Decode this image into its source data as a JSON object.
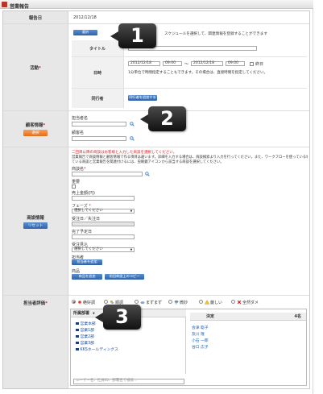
{
  "window": {
    "title": "営業報告"
  },
  "report_date": {
    "label": "報告日",
    "value": "2012/12/18"
  },
  "activity": {
    "label": "活動",
    "select_button": "選択",
    "select_hint": "スケジュールを選択して、関連情報を登録することができます",
    "title_label": "タイトル",
    "datetime_label": "日時",
    "start_date": "2012/12/18",
    "start_time": "09:00",
    "tilde": "～",
    "end_date": "2012/12/18",
    "end_time": "09:00",
    "allday_label": "終日",
    "time_hint": "1分単位で時間指定することもできます。その場合は、直接時間を指定してください。",
    "companion_label": "同行者",
    "companion_button": "同行者を追加する"
  },
  "customer": {
    "label": "顧客情報",
    "button": "選択",
    "contact_label": "担当者名",
    "customer_label": "顧客名"
  },
  "deal": {
    "label": "商談情報",
    "reset_button": "リセット",
    "notice_1": "二回目以降の商談はお客様と入力した商談を選択してください。",
    "notice_2": "営業報告で商談情報と顧客情報で作る項目は違います。詳細を入力する場合は、商談検索より入力を行ってください。また、ワークフローを使っている場合",
    "notice_3": "ている商談と営業報告を関連付けるには、虫眼鏡アイコンから該当する商談を選択してください。",
    "deal_name_label": "商談名",
    "important_label": "重要",
    "sales_amount_label": "売上金額(円)",
    "phase_label": "フェーズ",
    "phase_value": "選択してください",
    "order_date_label": "受注日／失注日",
    "completion_date_label": "完了予定日",
    "order_prospect_label": "受注見込",
    "order_prospect_value": "選択してください",
    "staff_label": "担当者",
    "staff_button": "担当者を追加",
    "product_label": "商品",
    "product_add_button": "商品を追加",
    "product_copy_button": "前回商談上のコピー"
  },
  "evaluation": {
    "label": "担当者評価",
    "options": [
      {
        "label": "絶好調",
        "selected": true,
        "icon": "sun-icon"
      },
      {
        "label": "順調",
        "selected": false,
        "icon": "sun-cloud-icon"
      },
      {
        "label": "まずまず",
        "selected": false,
        "icon": "cloud-icon"
      },
      {
        "label": "微妙",
        "selected": false,
        "icon": "rain-icon"
      },
      {
        "label": "厳しい",
        "selected": false,
        "icon": "warning-icon"
      },
      {
        "label": "全然ダメ",
        "selected": false,
        "icon": "cross-icon"
      }
    ],
    "dept_tab": "所属部署",
    "tree": [
      "営業本部",
      "営業1部",
      "営業2部",
      "営業3部",
      "KKSホールディングス"
    ],
    "decided_header": "決定",
    "count_header": "4名",
    "people": [
      "会津 聡子",
      "及川 隆",
      "小石 一郎",
      "谷口 広子"
    ],
    "search_placeholder": "ユーザー名、社員ID、部署名で検索..."
  },
  "callouts": {
    "one": "1",
    "two": "2",
    "three": "3"
  },
  "colors": {
    "accent_orange": "#e46d18",
    "accent_blue": "#2f64b0",
    "required": "#d02020",
    "callout": "#1a1a1a"
  }
}
